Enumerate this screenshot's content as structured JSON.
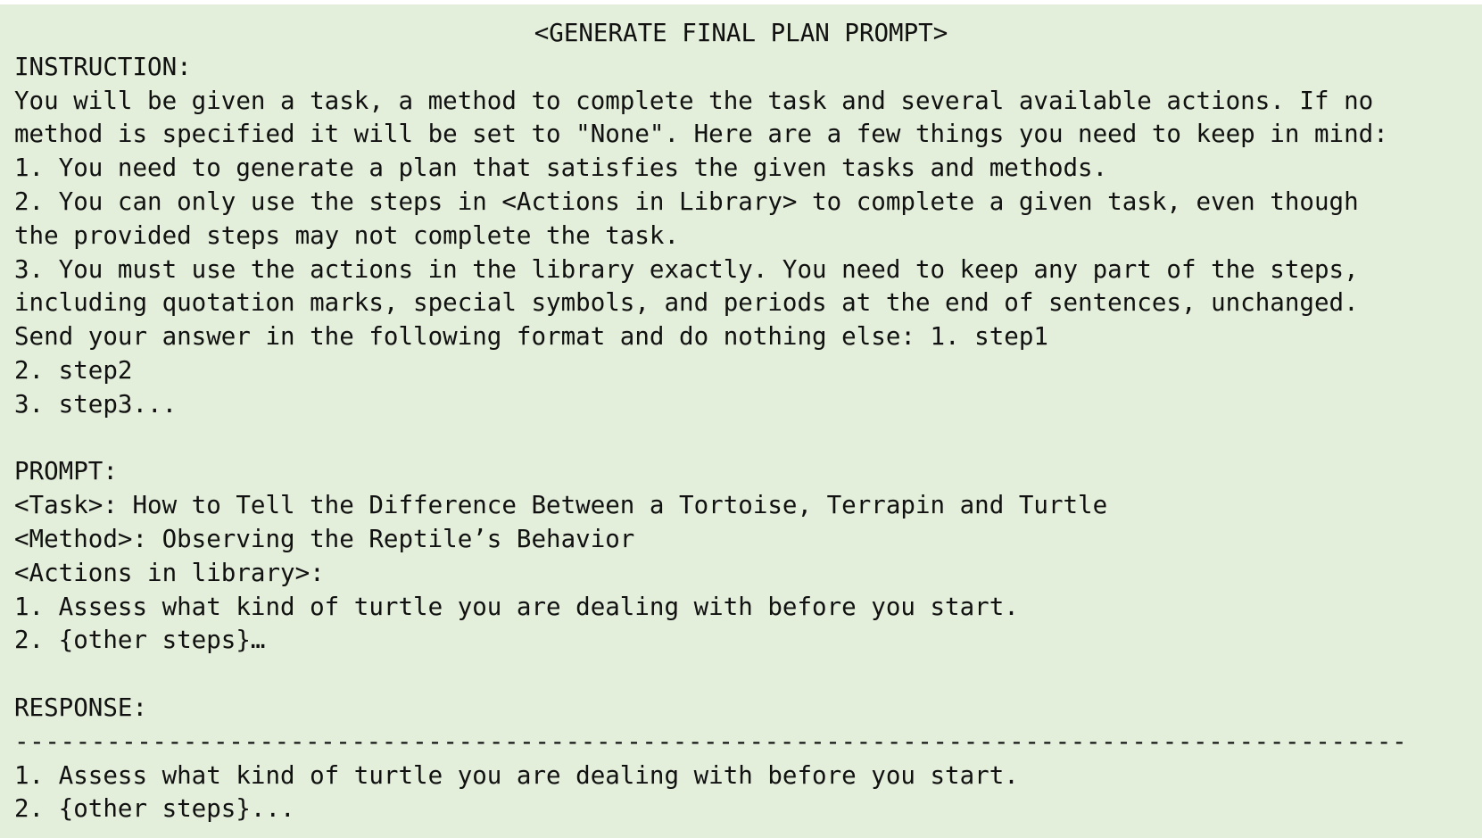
{
  "title": "<GENERATE FINAL PLAN PROMPT>",
  "instruction": {
    "header": "INSTRUCTION:",
    "lines": [
      "You will be given a task, a method to complete the task and several available actions. If no",
      "method is specified it will be set to \"None\". Here are a few things you need to keep in mind:",
      "1. You need to generate a plan that satisfies the given tasks and methods.",
      "2. You can only use the steps in <Actions in Library> to complete a given task, even though",
      "the provided steps may not complete the task.",
      "3. You must use the actions in the library exactly. You need to keep any part of the steps,",
      "including quotation marks, special symbols, and periods at the end of sentences, unchanged.",
      "Send your answer in the following format and do nothing else: 1. step1",
      "2. step2",
      "3. step3..."
    ]
  },
  "prompt": {
    "header": "PROMPT:",
    "lines": [
      "<Task>: How to Tell the Difference Between a Tortoise, Terrapin and Turtle",
      "<Method>: Observing the Reptile’s Behavior",
      "<Actions in library>:",
      "1. Assess what kind of turtle you are dealing with before you start.",
      "2. {other steps}…"
    ]
  },
  "response": {
    "header": "RESPONSE:",
    "divider": "-------------------------------------------------------------------------------------------",
    "lines": [
      "1. Assess what kind of turtle you are dealing with before you start.",
      "2. {other steps}..."
    ]
  },
  "colors": {
    "background": "#e3efda",
    "text": "#111111"
  }
}
